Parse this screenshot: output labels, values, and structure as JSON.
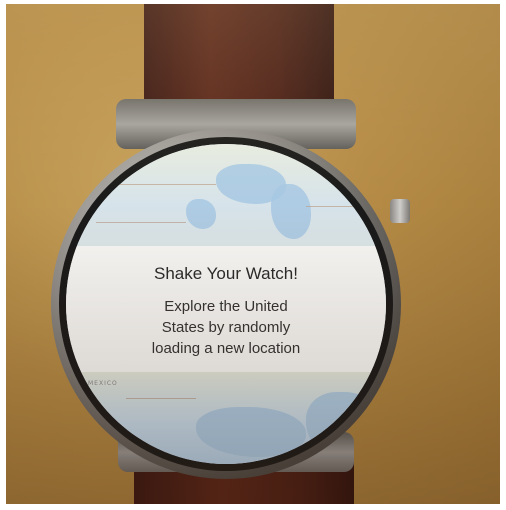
{
  "dialog": {
    "title": "Shake Your Watch!",
    "line1": "Explore the United",
    "line2": "States by randomly",
    "line3": "loading a new location"
  },
  "map": {
    "label_bottom_left": "MEXICO"
  },
  "colors": {
    "card_background": "#f8f8f6",
    "text": "#2b2b2b",
    "water": "#a7c8e3",
    "strap": "#5a2619",
    "table": "#b48a45"
  }
}
